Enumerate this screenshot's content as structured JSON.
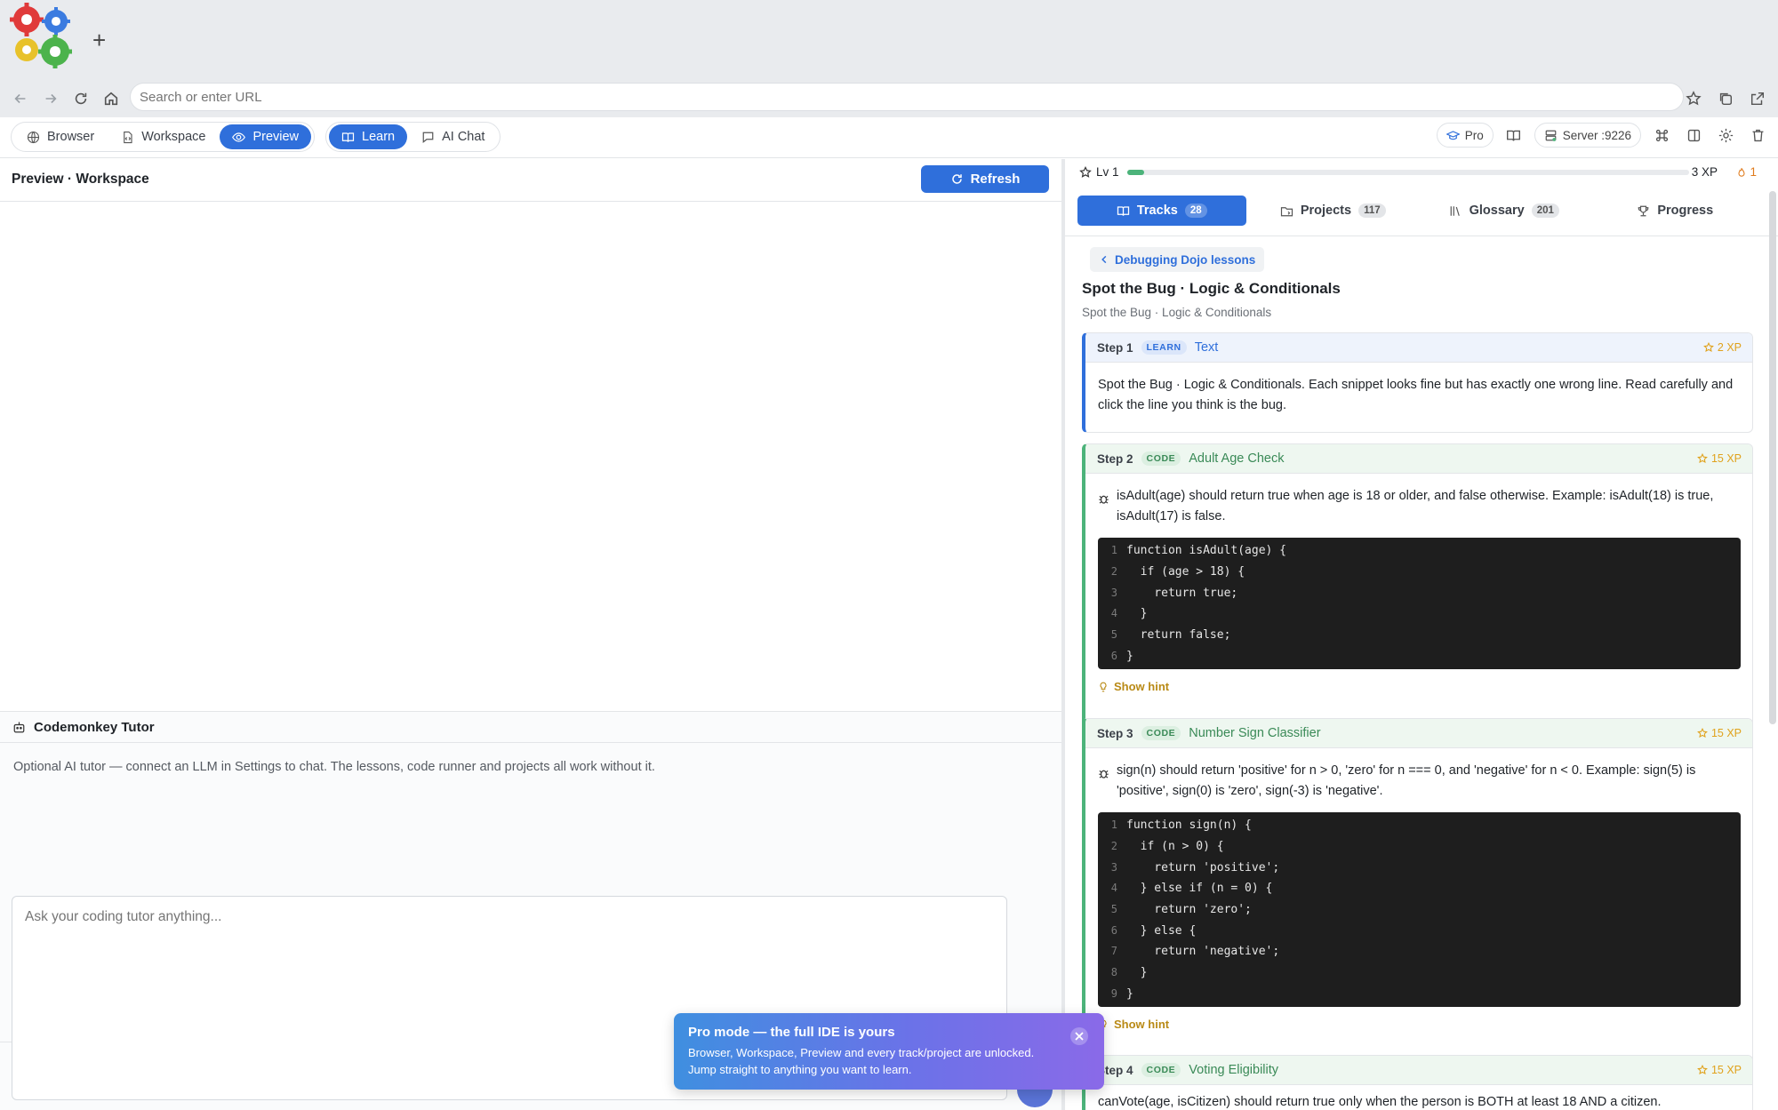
{
  "titlebar": {
    "new_tab": "+"
  },
  "urlbar": {
    "placeholder": "Search or enter URL"
  },
  "toolbar": {
    "tabs": [
      {
        "label": "Browser",
        "icon": "globe-icon"
      },
      {
        "label": "Workspace",
        "icon": "file-code-icon"
      },
      {
        "label": "Preview",
        "icon": "eye-icon"
      }
    ],
    "modes": [
      {
        "label": "Learn",
        "icon": "book-icon"
      },
      {
        "label": "AI Chat",
        "icon": "chat-icon"
      }
    ],
    "pro_label": "Pro",
    "server_label": "Server :9226"
  },
  "preview": {
    "title": "Preview · Workspace",
    "refresh_label": "Refresh"
  },
  "tutor": {
    "title": "Codemonkey Tutor",
    "note": "Optional AI tutor — connect an LLM in Settings to chat. The lessons, code runner and projects all work without it.",
    "chat_placeholder": "Ask your coding tutor anything..."
  },
  "progress": {
    "level": "Lv 1",
    "xp": "3 XP",
    "streak": "1",
    "level_fraction": 0.03
  },
  "learn_tabs": [
    {
      "label": "Tracks",
      "count": "28"
    },
    {
      "label": "Projects",
      "count": "117"
    },
    {
      "label": "Glossary",
      "count": "201"
    },
    {
      "label": "Progress",
      "count": ""
    }
  ],
  "lesson": {
    "back_label": "Debugging Dojo lessons",
    "title": "Spot the Bug · Logic & Conditionals",
    "subtitle": "Spot the Bug · Logic & Conditionals",
    "hint_label": "Show hint",
    "steps": [
      {
        "num": "Step 1",
        "kind": "LEARN",
        "name": "Text",
        "xp": "2 XP",
        "text": "Spot the Bug · Logic & Conditionals. Each snippet looks fine but has exactly one wrong line. Read carefully and click the line you think is the bug."
      },
      {
        "num": "Step 2",
        "kind": "CODE",
        "name": "Adult Age Check",
        "xp": "15 XP",
        "text": "isAdult(age) should return true when age is 18 or older, and false otherwise. Example: isAdult(18) is true, isAdult(17) is false.",
        "code": [
          "function isAdult(age) {",
          "  if (age > 18) {",
          "    return true;",
          "  }",
          "  return false;",
          "}"
        ]
      },
      {
        "num": "Step 3",
        "kind": "CODE",
        "name": "Number Sign Classifier",
        "xp": "15 XP",
        "text": "sign(n) should return 'positive' for n > 0, 'zero' for n === 0, and 'negative' for n < 0. Example: sign(5) is 'positive', sign(0) is 'zero', sign(-3) is 'negative'.",
        "code": [
          "function sign(n) {",
          "  if (n > 0) {",
          "    return 'positive';",
          "  } else if (n = 0) {",
          "    return 'zero';",
          "  } else {",
          "    return 'negative';",
          "  }",
          "}"
        ]
      },
      {
        "num": "Step 4",
        "kind": "CODE",
        "name": "Voting Eligibility",
        "xp": "15 XP",
        "text": "canVote(age, isCitizen) should return true only when the person is BOTH at least 18 AND a citizen."
      }
    ]
  },
  "toast": {
    "title": "Pro mode — the full IDE is yours",
    "body": "Browser, Workspace, Preview and every track/project are unlocked. Jump straight to anything you want to learn."
  },
  "colors": {
    "accent": "#2f6fdb",
    "success": "#4cb37a",
    "xp": "#e0a21c"
  }
}
